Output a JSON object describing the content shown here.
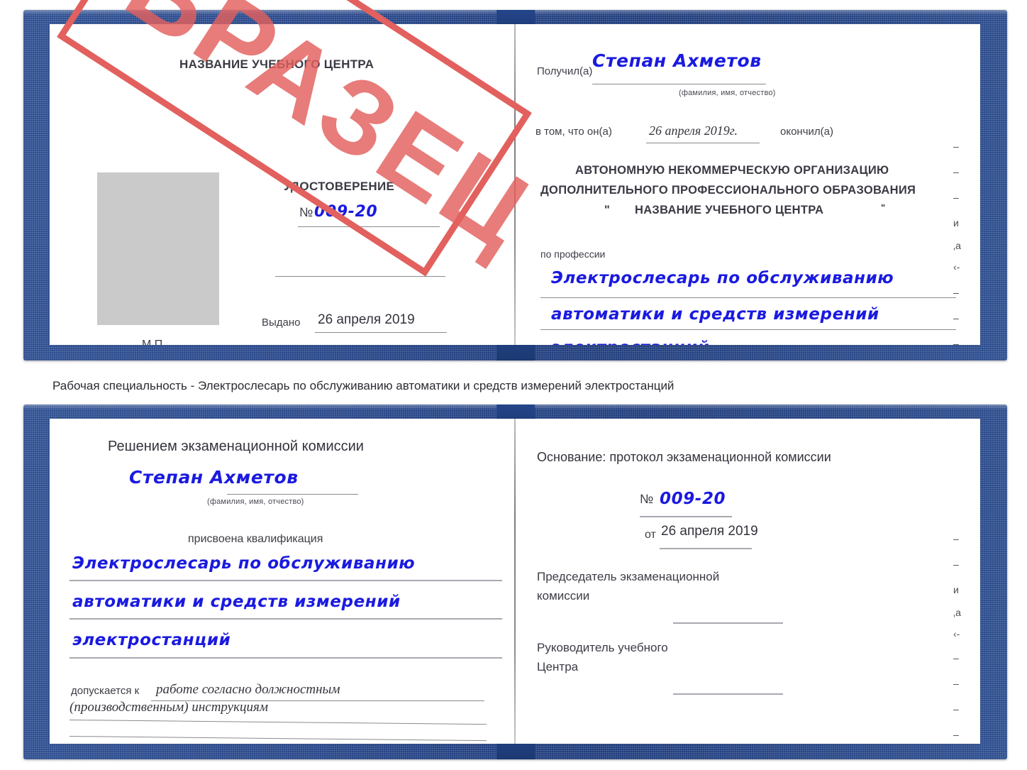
{
  "stamp": {
    "text": "ОБРАЗЕЦ",
    "color": "#e2605e"
  },
  "colors": {
    "cover_blue": "#27478a",
    "handwriting_blue": "#1a1ae0",
    "page_white": "#ffffff",
    "photo_placeholder_gray": "#cacaca",
    "rule_gray": "#8a8a92"
  },
  "caption": "Рабочая специальность - Электрослесарь по обслуживанию автоматики и средств измерений электростанций",
  "certificate_top": {
    "left_page": {
      "org_title": "НАЗВАНИЕ УЧЕБНОГО ЦЕНТРА",
      "doc_type": "УДОСТОВЕРЕНИЕ",
      "number_label": "№",
      "number_value": "009-20",
      "issued_label": "Выдано",
      "issued_value": "26 апреля 2019",
      "seal_label": "М.П.",
      "photo_placeholder": "photo-box"
    },
    "right_page": {
      "received_label": "Получил(а)",
      "received_value": "Степан Ахметов",
      "name_hint": "(фамилия, имя, отчество)",
      "in_that_label": "в том, что он(а)",
      "in_that_value": "26 апреля 2019г.",
      "finished_label": "окончил(а)",
      "org_line1": "АВТОНОМНУЮ НЕКОММЕРЧЕСКУЮ ОРГАНИЗАЦИЮ",
      "org_line2": "ДОПОЛНИТЕЛЬНОГО ПРОФЕССИОНАЛЬНОГО ОБРАЗОВАНИЯ",
      "org_quote_open": "\"",
      "org_line3": "НАЗВАНИЕ УЧЕБНОГО ЦЕНТРА",
      "org_quote_close": "\"",
      "profession_label": "по профессии",
      "profession_line1": "Электрослесарь по обслуживанию",
      "profession_line2": "автоматики и средств измерений",
      "profession_line3": "электростанций",
      "margin_marks": [
        "–",
        "–",
        "–",
        "и",
        "‚а",
        "‹-",
        "–",
        "–",
        "–"
      ]
    }
  },
  "certificate_bottom": {
    "left_page": {
      "decision_title": "Решением экзаменационной комиссии",
      "name_value": "Степан Ахметов",
      "name_hint": "(фамилия, имя, отчество)",
      "qualification_label": "присвоена квалификация",
      "qualification_line1": "Электрослесарь по обслуживанию",
      "qualification_line2": "автоматики и средств измерений",
      "qualification_line3": "электростанций",
      "admitted_label": "допускается к",
      "admitted_value1": "работе согласно должностным",
      "admitted_value2": "(производственным) инструкциям"
    },
    "right_page": {
      "basis_label": "Основание: протокол экзаменационной комиссии",
      "number_label": "№",
      "number_value": "009-20",
      "date_label": "от",
      "date_value": "26 апреля 2019",
      "chairman_line1": "Председатель экзаменационной",
      "chairman_line2": "комиссии",
      "head_line1": "Руководитель учебного",
      "head_line2": "Центра",
      "margin_marks": [
        "–",
        "–",
        "–",
        "и",
        "‚а",
        "‹-",
        "–",
        "–",
        "–",
        "–"
      ]
    }
  }
}
